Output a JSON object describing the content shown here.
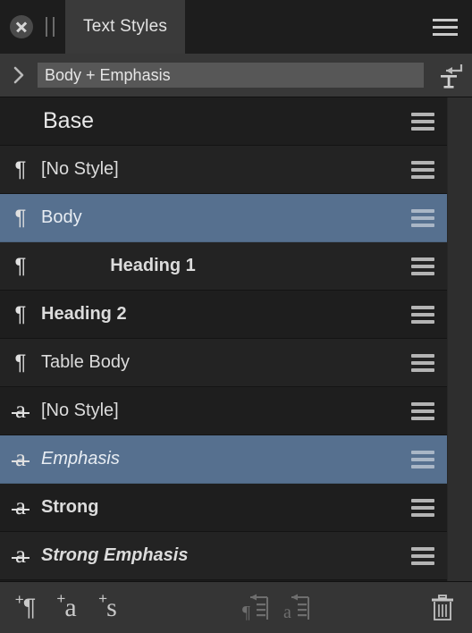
{
  "window": {
    "tab_label": "Text Styles",
    "close_icon": "close-circle-icon",
    "grip_icon": "drag-grip-icon",
    "menu_icon": "hamburger-menu-icon"
  },
  "stylebar": {
    "disclosure_icon": "chevron-right-icon",
    "current_style": "Body + Emphasis",
    "reset_icon": "reset-text-format-icon",
    "reset_label": "T"
  },
  "style_list": [
    {
      "name": "Base",
      "icon": "none",
      "kind": "base",
      "selected": false,
      "weight": "base",
      "align": "left"
    },
    {
      "name": "[No Style]",
      "icon": "pilcrow",
      "kind": "paragraph",
      "selected": false,
      "weight": "normal",
      "align": "left"
    },
    {
      "name": "Body",
      "icon": "pilcrow",
      "kind": "paragraph",
      "selected": true,
      "weight": "normal",
      "align": "left"
    },
    {
      "name": "Heading 1",
      "icon": "pilcrow",
      "kind": "paragraph",
      "selected": false,
      "weight": "bold",
      "align": "center"
    },
    {
      "name": "Heading 2",
      "icon": "pilcrow",
      "kind": "paragraph",
      "selected": false,
      "weight": "bold",
      "align": "left"
    },
    {
      "name": "Table Body",
      "icon": "pilcrow",
      "kind": "paragraph",
      "selected": false,
      "weight": "normal",
      "align": "left"
    },
    {
      "name": "[No Style]",
      "icon": "char-a",
      "kind": "character",
      "selected": false,
      "weight": "normal",
      "align": "left"
    },
    {
      "name": "Emphasis",
      "icon": "char-a",
      "kind": "character",
      "selected": true,
      "weight": "italic",
      "align": "left"
    },
    {
      "name": "Strong",
      "icon": "char-a",
      "kind": "character",
      "selected": false,
      "weight": "bold",
      "align": "left"
    },
    {
      "name": "Strong Emphasis",
      "icon": "char-a",
      "kind": "character",
      "selected": false,
      "weight": "bolditalic",
      "align": "left"
    }
  ],
  "row_icon_glyphs": {
    "pilcrow": "¶",
    "char-a": "a"
  },
  "toolbar": {
    "add_paragraph_style": {
      "label": "¶",
      "plus": "+",
      "name": "new-paragraph-style"
    },
    "add_character_style": {
      "label": "a",
      "plus": "+",
      "name": "new-character-style"
    },
    "add_section_style": {
      "label": "s",
      "plus": "+",
      "name": "new-line-style"
    },
    "redefine_paragraph_style": {
      "label": "¶",
      "enabled": false
    },
    "redefine_character_style": {
      "label": "a",
      "enabled": false
    },
    "delete_style": {
      "icon": "trash-icon",
      "enabled": true
    }
  },
  "colors": {
    "selection_blue": "#56708f",
    "panel_bg": "#2e2e2e",
    "list_bg": "#1e1e1e",
    "titlebar_bg": "#1d1d1d",
    "tab_active_bg": "#3a3a3a",
    "field_bg": "#575757",
    "toolbar_bg": "#353535",
    "text": "#dcdcdc"
  }
}
